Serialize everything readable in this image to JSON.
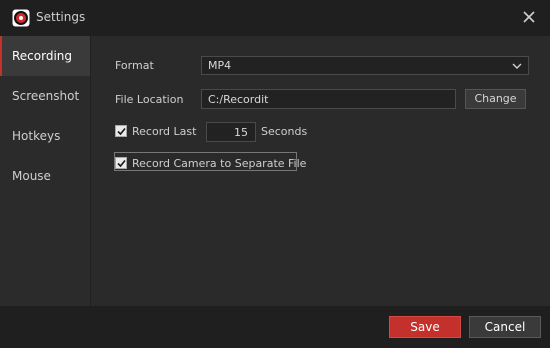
{
  "window": {
    "title": "Settings"
  },
  "sidebar": {
    "items": [
      {
        "label": "Recording",
        "active": true
      },
      {
        "label": "Screenshot",
        "active": false
      },
      {
        "label": "Hotkeys",
        "active": false
      },
      {
        "label": "Mouse",
        "active": false
      }
    ]
  },
  "recording": {
    "format_label": "Format",
    "format_value": "MP4",
    "file_location_label": "File Location",
    "file_location_value": "C:/Recordit",
    "change_label": "Change",
    "record_last_label": "Record Last",
    "record_last_value": "15",
    "record_last_checked": true,
    "seconds_label": "Seconds",
    "camera_label": "Record Camera to Separate File",
    "camera_checked": true
  },
  "footer": {
    "save_label": "Save",
    "cancel_label": "Cancel"
  },
  "colors": {
    "accent": "#c4302b",
    "background": "#2a2a2a",
    "titlebar": "#1f1f1f",
    "sidebar_active": "#3a3a3a"
  },
  "icons": {
    "app": "record-app-icon",
    "close": "close-icon",
    "dropdown": "chevron-down-icon",
    "check": "checkmark-icon"
  }
}
